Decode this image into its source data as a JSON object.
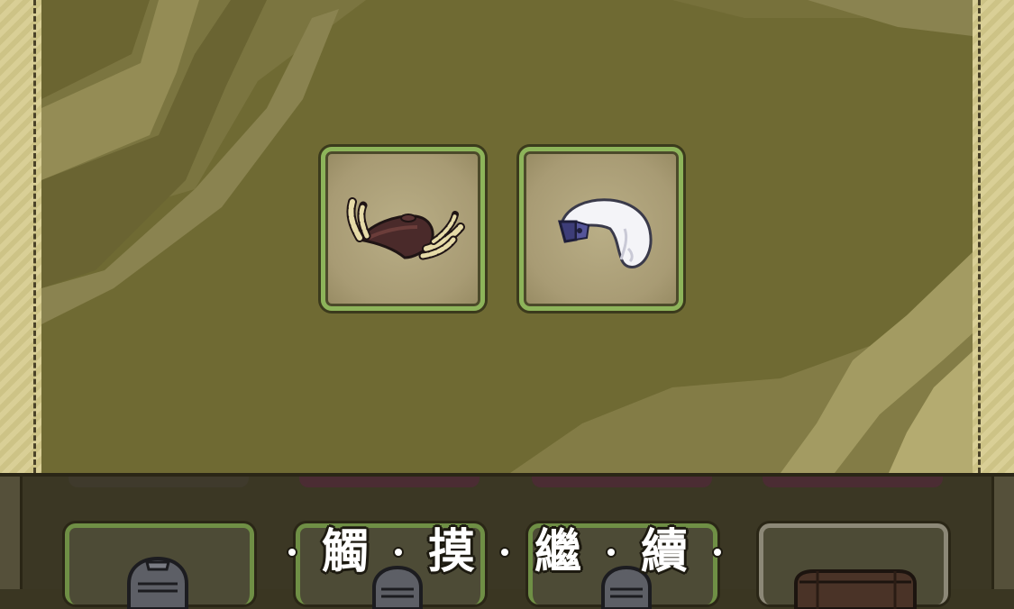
{
  "reward_screen": {
    "items": [
      {
        "icon": "dark-claw-gauntlet-icon",
        "frame_color": "#8db45a"
      },
      {
        "icon": "white-ghost-glove-icon",
        "frame_color": "#8db45a"
      }
    ]
  },
  "continue_prompt": {
    "chars": [
      "觸",
      "摸",
      "繼",
      "續"
    ]
  },
  "bottom_cards": [
    {
      "icon": "knight-helmet-icon",
      "frame_color": "#6f8f45"
    },
    {
      "icon": "knight-helmet-icon",
      "frame_color": "#6f8f45"
    },
    {
      "icon": "knight-helmet-icon",
      "frame_color": "#6f8f45"
    },
    {
      "icon": "treasure-chest-icon",
      "frame_color": "#8c8877"
    }
  ]
}
